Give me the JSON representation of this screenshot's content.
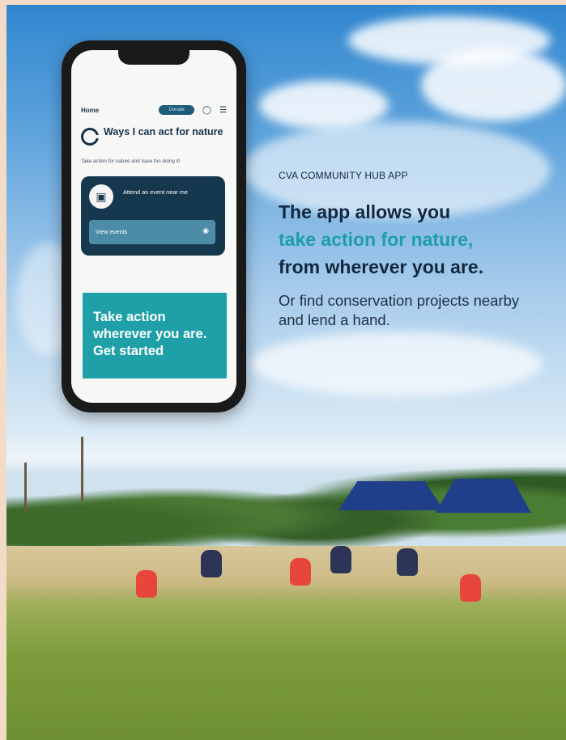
{
  "phone": {
    "nav": {
      "home": "Home",
      "donate": "Donate"
    },
    "title": "Ways I can act for nature",
    "subtitle": "Take action for nature and have fun doing it!",
    "card": {
      "text": "Attend an event near me",
      "button": "View events"
    },
    "promo": {
      "text": "Take action wherever you are. Get started"
    }
  },
  "ad": {
    "eyebrow": "CVA COMMUNITY HUB APP",
    "headline": {
      "line1": "The app allows you",
      "line2": "take action for nature,",
      "line3": "from wherever you are."
    },
    "body": "Or find conservation projects nearby and lend a hand."
  },
  "colors": {
    "navy": "#13283f",
    "teal": "#1d9ea6",
    "card": "#16384f"
  },
  "icons": [
    "cva-logo-icon",
    "user-icon",
    "menu-icon",
    "map-icon",
    "arrow-circle-icon"
  ]
}
